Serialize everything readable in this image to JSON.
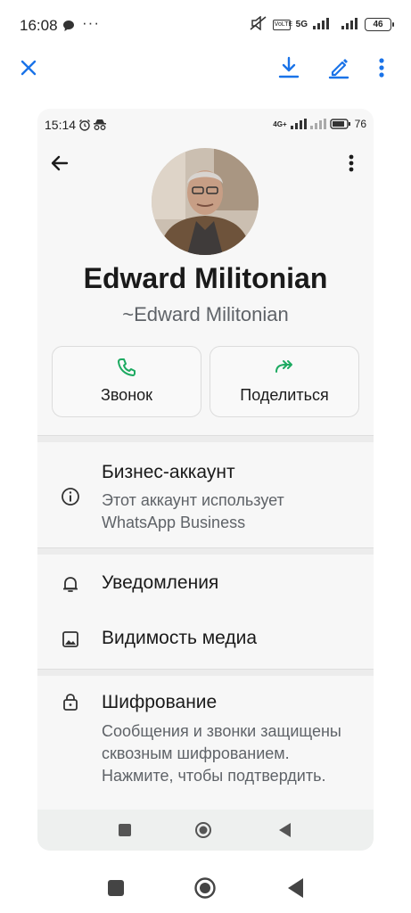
{
  "status_bar": {
    "time": "16:08",
    "dots": "···",
    "battery": "46",
    "network": "5G",
    "volte": "VoLTE"
  },
  "toolbar": {
    "close_icon": "close-icon",
    "download_icon": "download-icon",
    "edit_icon": "edit-icon",
    "more_icon": "more-vert-icon",
    "accent": "#1a73e8"
  },
  "screenshot": {
    "status_bar": {
      "time": "15:14",
      "battery": "76",
      "network": "4G+"
    },
    "profile": {
      "name": "Edward Militonian",
      "subname": "~Edward Militonian"
    },
    "actions": [
      {
        "label": "Звонок",
        "icon": "phone-icon"
      },
      {
        "label": "Поделиться",
        "icon": "share-arrow-icon"
      }
    ],
    "business": {
      "title": "Бизнес-аккаунт",
      "subtitle": "Этот аккаунт использует WhatsApp Business"
    },
    "notifications": {
      "label": "Уведомления"
    },
    "media": {
      "label": "Видимость медиа"
    },
    "encryption": {
      "title": "Шифрование",
      "subtitle": "Сообщения и звонки защищены сквозным шифрованием. Нажмите, чтобы подтвердить."
    },
    "green": "#1daa61"
  }
}
